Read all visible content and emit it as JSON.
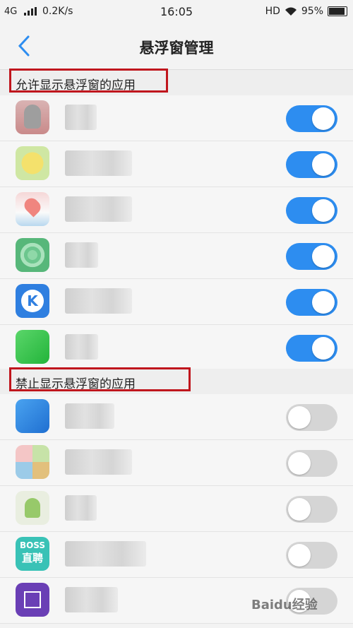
{
  "status_bar": {
    "network": "4G",
    "speed": "0.2K/s",
    "time": "16:05",
    "hd": "HD",
    "battery": "95%"
  },
  "header": {
    "title": "悬浮窗管理",
    "back_icon": "chevron-left-icon"
  },
  "colors": {
    "accent": "#2d8df0",
    "highlight_frame": "#c0161d"
  },
  "allowed_section": {
    "title": "允许显示悬浮窗的应用",
    "apps": [
      {
        "icon": "penguin-app-icon",
        "enabled": true
      },
      {
        "icon": "yellow-app-icon",
        "enabled": true
      },
      {
        "icon": "map-app-icon",
        "enabled": true
      },
      {
        "icon": "green-wave-app-icon",
        "enabled": true
      },
      {
        "icon": "k-app-icon",
        "enabled": true
      },
      {
        "icon": "green-app-icon",
        "enabled": true
      }
    ]
  },
  "blocked_section": {
    "title": "禁止显示悬浮窗的应用",
    "apps": [
      {
        "icon": "blue-app-icon",
        "enabled": false
      },
      {
        "icon": "tiles-app-icon",
        "enabled": false
      },
      {
        "icon": "android-app-icon",
        "enabled": false
      },
      {
        "icon": "boss-app-icon",
        "icon_text": [
          "BOSS",
          "直聘"
        ],
        "enabled": false
      },
      {
        "icon": "chip-app-icon",
        "enabled": false
      }
    ]
  },
  "watermark": "Baidu经验"
}
